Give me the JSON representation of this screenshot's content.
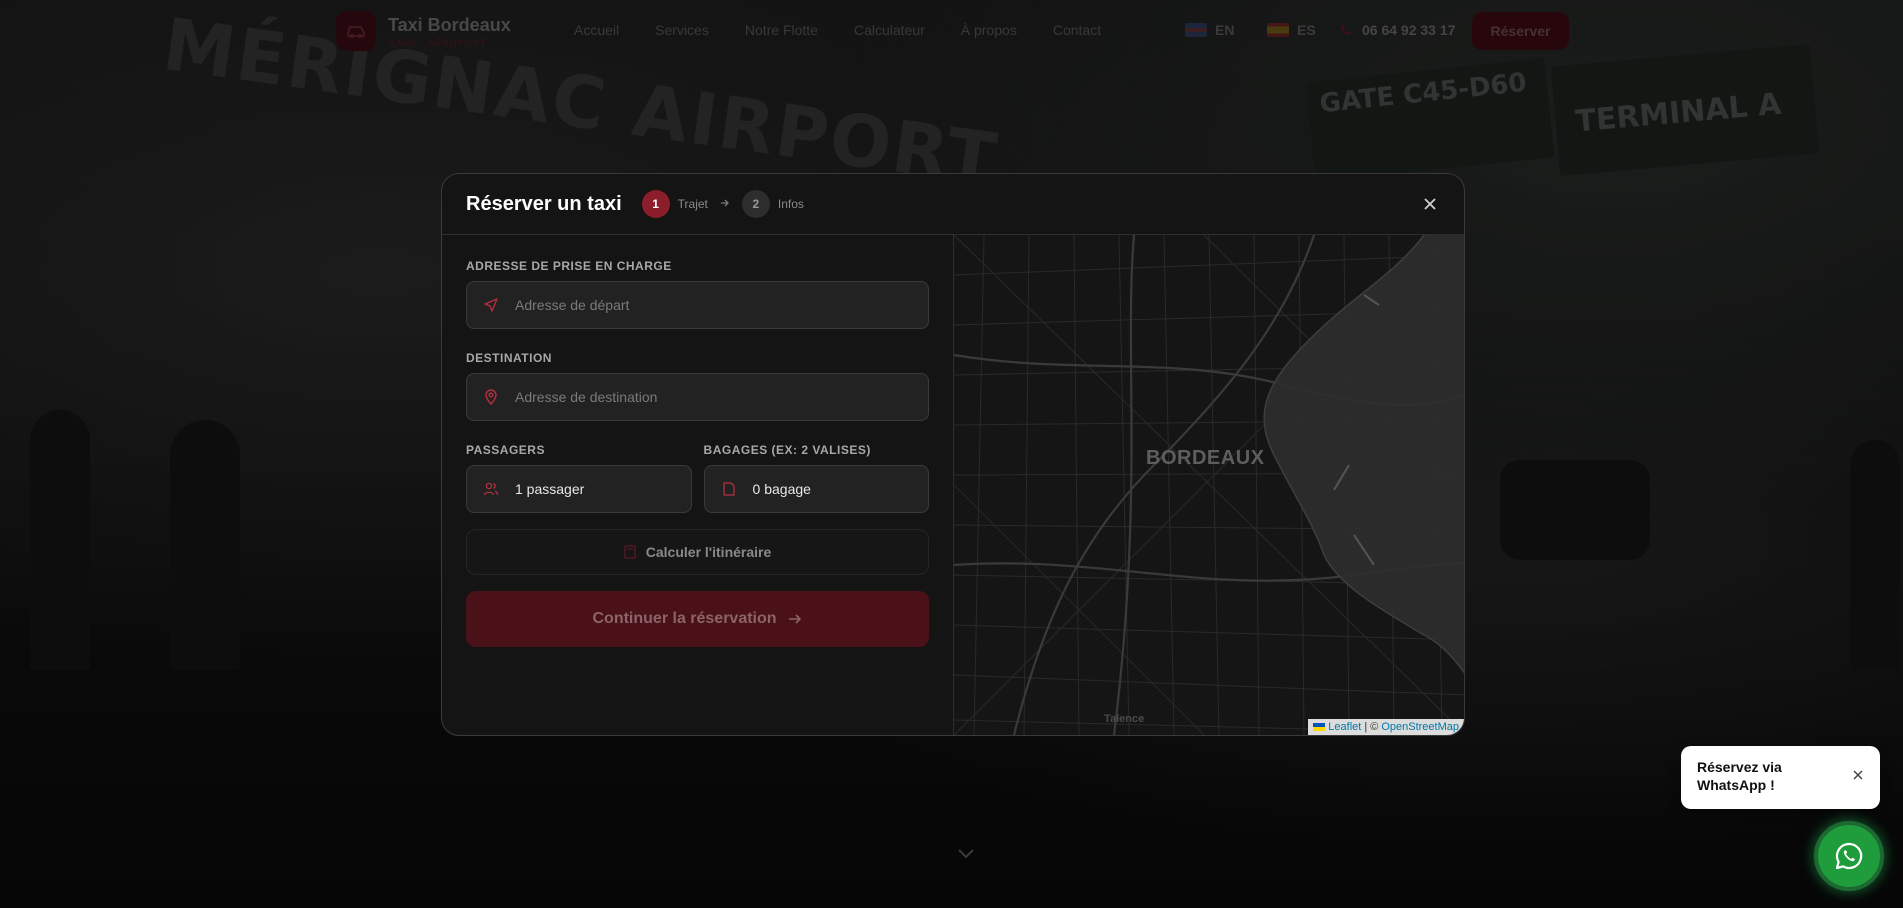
{
  "header": {
    "brand_name": "Taxi Bordeaux",
    "brand_sub": "GARE · AÉROPORT",
    "nav": [
      "Accueil",
      "Services",
      "Notre Flotte",
      "Calculateur",
      "À propos",
      "Contact"
    ],
    "lang_en": "EN",
    "lang_es": "ES",
    "phone": "06 64 92 33 17",
    "book_label": "Réserver"
  },
  "background": {
    "sign_airport": "MÉRIGNAC AIRPORT",
    "sign_gate": "GATE C45-D60",
    "sign_terminal": "TERMINAL A"
  },
  "modal": {
    "title": "Réserver un taxi",
    "steps": [
      {
        "num": "1",
        "label": "Trajet"
      },
      {
        "num": "2",
        "label": "Infos"
      }
    ],
    "pickup_label": "Adresse de prise en charge",
    "pickup_placeholder": "Adresse de départ",
    "destination_label": "Destination",
    "destination_placeholder": "Adresse de destination",
    "passengers_label": "Passagers",
    "passengers_value": "1 passager",
    "luggage_label": "Bagages (ex: 2 valises)",
    "luggage_value": "0 bagage",
    "calc_label": "Calculer l'itinéraire",
    "continue_label": "Continuer la réservation"
  },
  "map": {
    "city_label": "BORDEAUX",
    "area_label": "Talence",
    "attrib_leaflet": "Leaflet",
    "attrib_sep": "| ©",
    "attrib_osm": "OpenStreetMap"
  },
  "whatsapp": {
    "toast_text": "Réservez via WhatsApp !"
  },
  "colors": {
    "accent": "#8c1d2a",
    "whatsapp": "#25d366"
  }
}
